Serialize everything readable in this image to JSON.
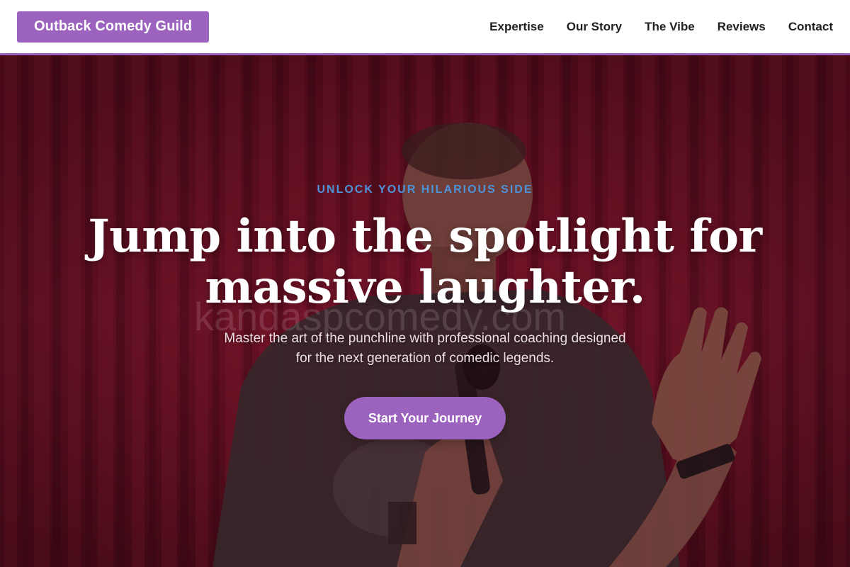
{
  "header": {
    "brand": "Outback Comedy Guild",
    "nav": [
      {
        "label": "Expertise"
      },
      {
        "label": "Our Story"
      },
      {
        "label": "The Vibe"
      },
      {
        "label": "Reviews"
      },
      {
        "label": "Contact"
      }
    ]
  },
  "hero": {
    "eyebrow": "UNLOCK YOUR HILARIOUS SIDE",
    "title_line1": "Jump into the spotlight for",
    "title_line2": "massive laughter.",
    "subtitle_line1": "Master the art of the punchline with professional coaching designed",
    "subtitle_line2": "for the next generation of comedic legends.",
    "cta_label": "Start Your Journey",
    "watermark": "kandaspcomedy.com"
  },
  "colors": {
    "brand": "#9b62be",
    "eyebrow": "#4e93d8",
    "curtain": "#9a1630",
    "nav_text": "#1f1f1f"
  }
}
